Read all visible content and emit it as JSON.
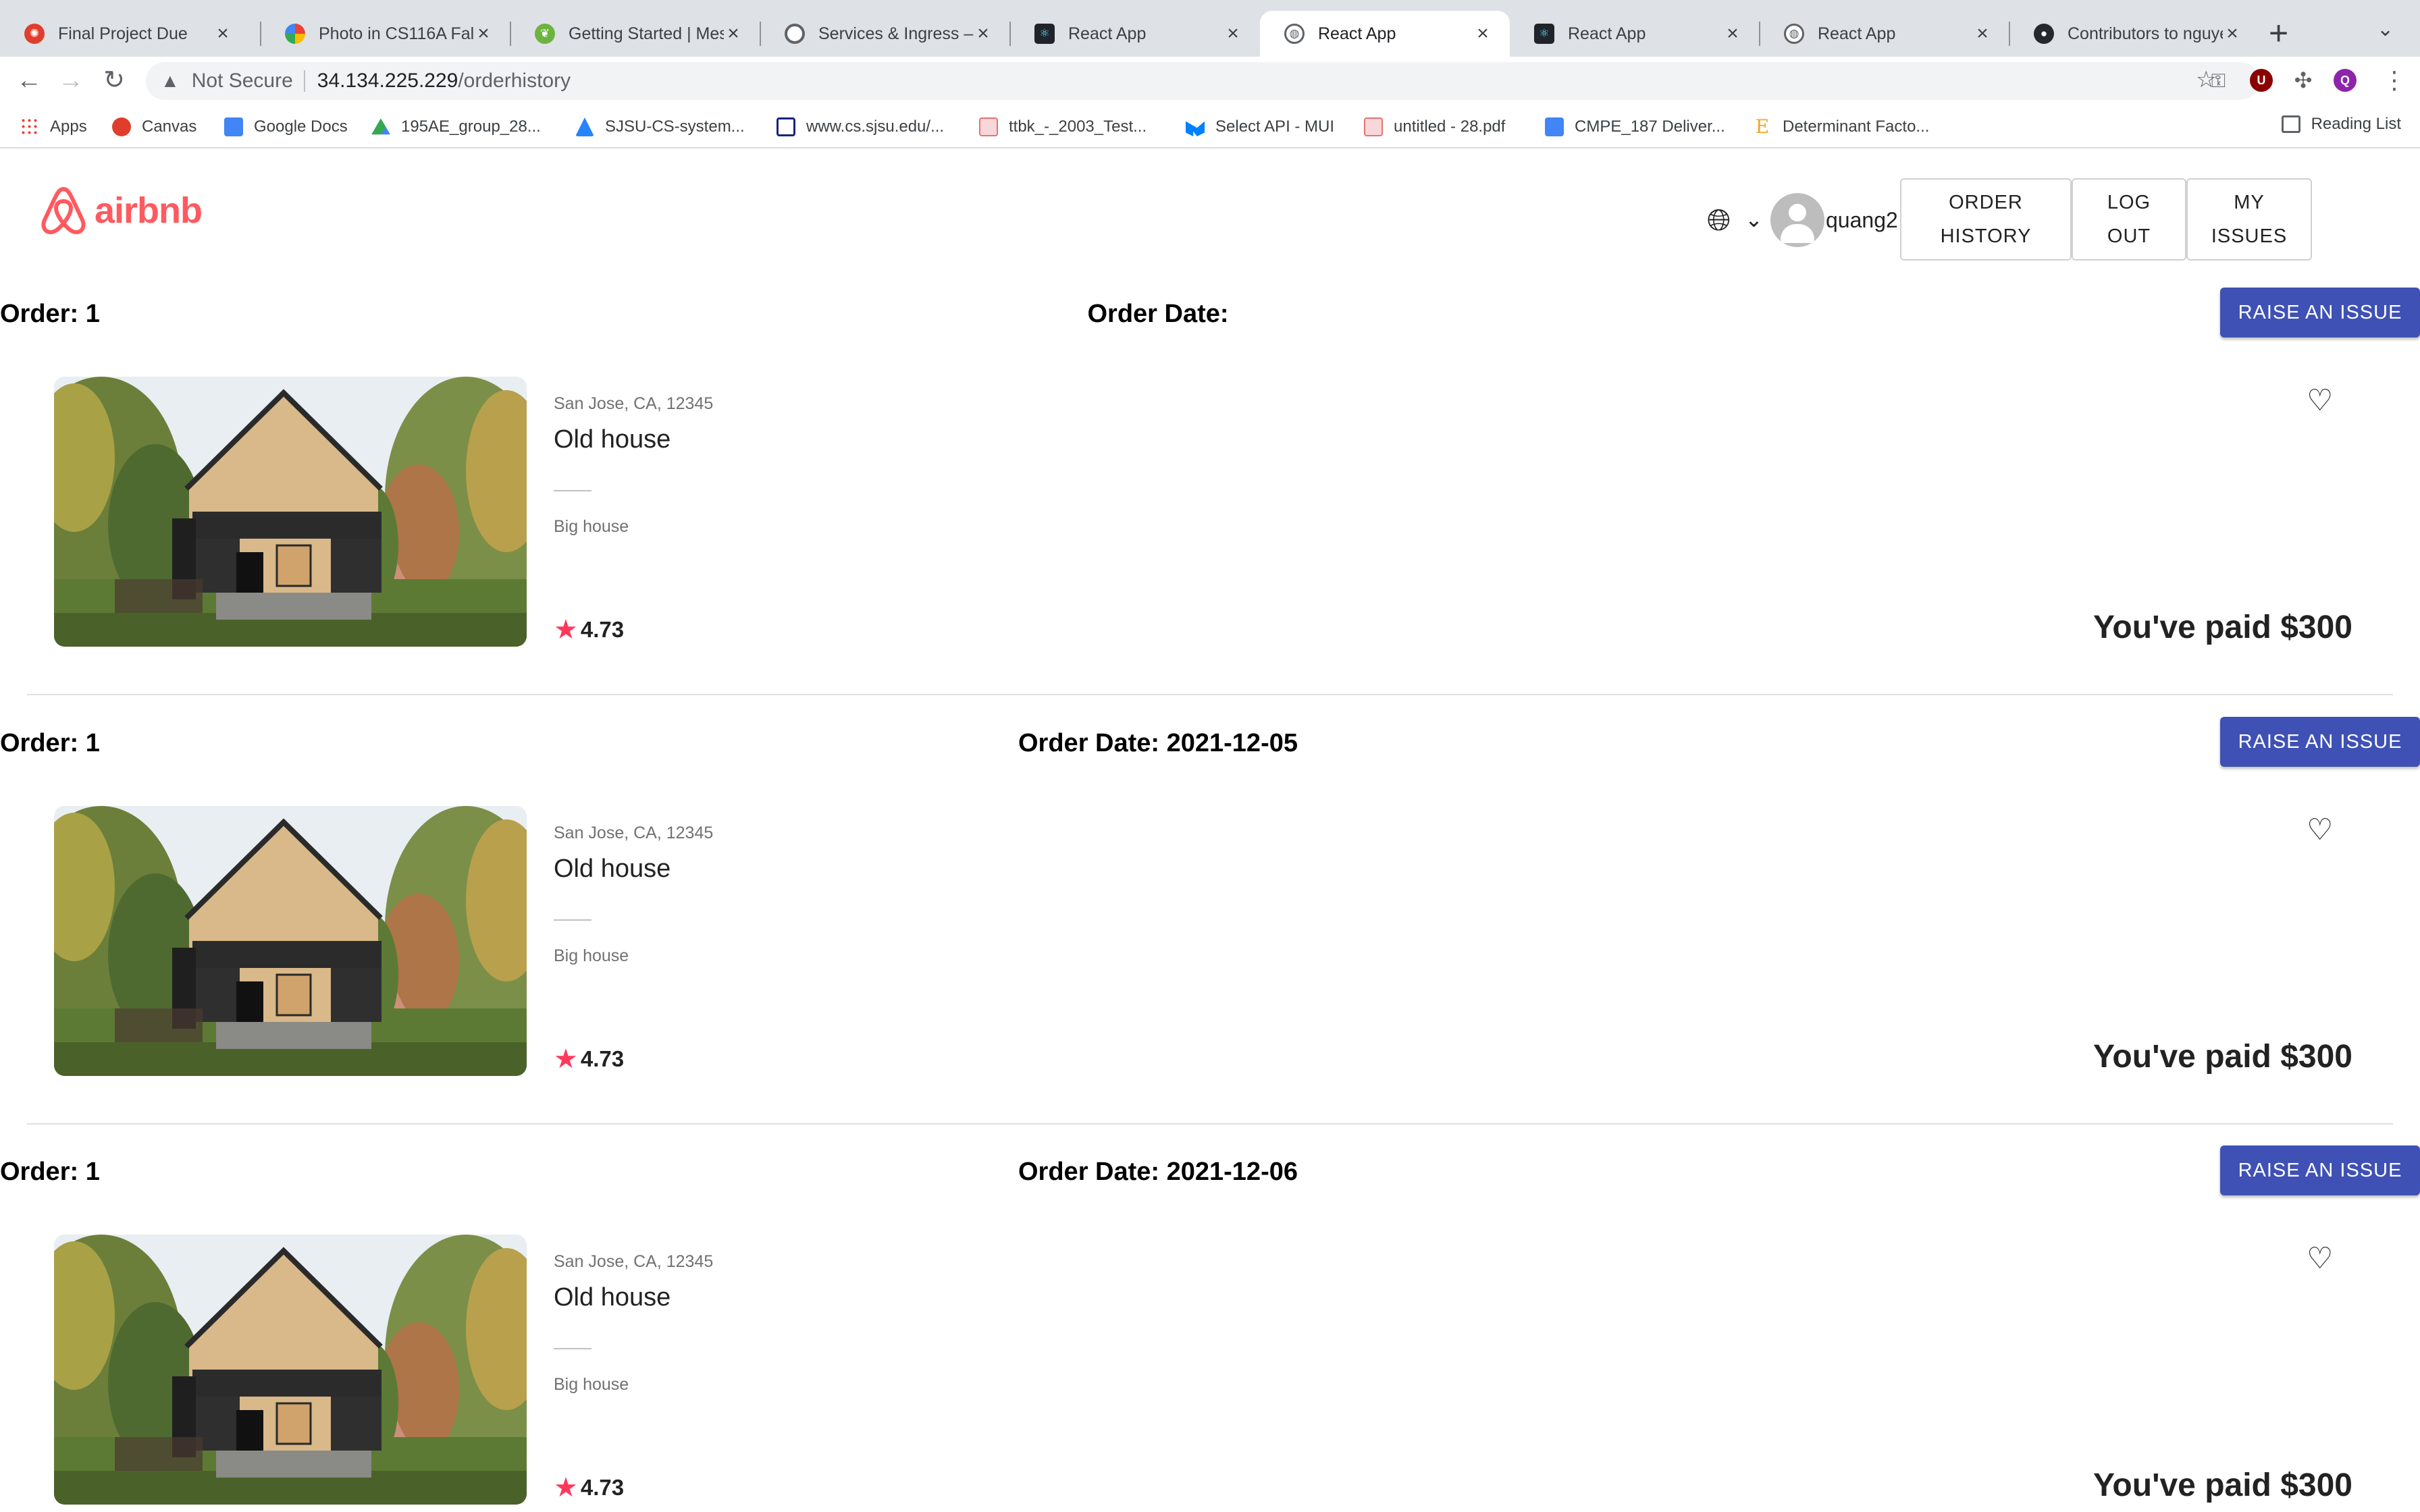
{
  "browser": {
    "tabs": [
      {
        "title": "Final Project Due",
        "icon": "canvas-icon",
        "color": "#e03e2d"
      },
      {
        "title": "Photo in CS116A Fall",
        "icon": "google-photos-icon",
        "color": "#fbbc04"
      },
      {
        "title": "Getting Started | Mes",
        "icon": "spring-icon",
        "color": "#6db33f"
      },
      {
        "title": "Services & Ingress – ",
        "icon": "gcp-icon",
        "color": "#5f6368"
      },
      {
        "title": "React App",
        "icon": "react-icon",
        "color": "#20232a"
      },
      {
        "title": "React App",
        "icon": "globe-icon",
        "color": "#5f6368"
      },
      {
        "title": "React App",
        "icon": "react-icon",
        "color": "#20232a"
      },
      {
        "title": "React App",
        "icon": "globe-icon",
        "color": "#5f6368"
      },
      {
        "title": "Contributors to nguye",
        "icon": "github-icon",
        "color": "#24292e"
      }
    ],
    "url_warning": "Not Secure",
    "url_host": "34.134.225.229",
    "url_path": "/orderhistory",
    "bookmarks": [
      {
        "label": "Apps",
        "color": "#ea4335"
      },
      {
        "label": "Canvas",
        "color": "#e03e2d"
      },
      {
        "label": "Google Docs",
        "color": "#4285f4"
      },
      {
        "label": "195AE_group_28...",
        "color": "#fbbc04"
      },
      {
        "label": "SJSU-CS-system...",
        "color": "#2684ff"
      },
      {
        "label": "www.cs.sjsu.edu/...",
        "color": "#1a237e"
      },
      {
        "label": "ttbk_-_2003_Test...",
        "color": "#e57373"
      },
      {
        "label": "Select API - MUI",
        "color": "#007fff"
      },
      {
        "label": "untitled - 28.pdf",
        "color": "#e57373"
      },
      {
        "label": "CMPE_187 Deliver...",
        "color": "#4285f4"
      },
      {
        "label": "Determinant Facto...",
        "color": "#f5a623"
      }
    ],
    "reading_list": "Reading List",
    "extensions": [
      {
        "label": "U",
        "color": "#8b0000"
      },
      {
        "label": "Q",
        "color": "#8e24aa"
      }
    ]
  },
  "header": {
    "logo_text": "airbnb",
    "brand_color": "#ff5a5f",
    "username": "quang2",
    "nav": [
      {
        "line1": "ORDER",
        "line2": "HISTORY"
      },
      {
        "line1": "LOG",
        "line2": "OUT"
      },
      {
        "line1": "MY",
        "line2": "ISSUES"
      }
    ]
  },
  "orders": [
    {
      "order_label": "Order: 1",
      "date_label": "Order Date:",
      "button": "RAISE AN ISSUE",
      "location": "San Jose, CA, 12345",
      "title": "Old house",
      "description": "Big house",
      "rating": "4.73",
      "paid": "You've paid $300"
    },
    {
      "order_label": "Order: 1",
      "date_label": "Order Date: 2021-12-05",
      "button": "RAISE AN ISSUE",
      "location": "San Jose, CA, 12345",
      "title": "Old house",
      "description": "Big house",
      "rating": "4.73",
      "paid": "You've paid $300"
    },
    {
      "order_label": "Order: 1",
      "date_label": "Order Date: 2021-12-06",
      "button": "RAISE AN ISSUE",
      "location": "San Jose, CA, 12345",
      "title": "Old house",
      "description": "Big house",
      "rating": "4.73",
      "paid": "You've paid $300"
    }
  ],
  "button_color": "#3f51b5"
}
